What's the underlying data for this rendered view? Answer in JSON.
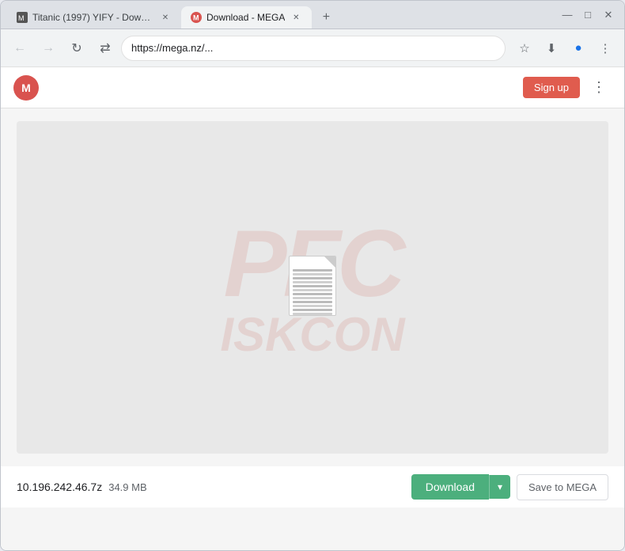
{
  "browser": {
    "tabs": [
      {
        "id": "tab1",
        "title": "Titanic (1997) YIFY - Download...",
        "favicon": "film",
        "active": false
      },
      {
        "id": "tab2",
        "title": "Download - MEGA",
        "favicon": "mega",
        "active": true
      }
    ],
    "url": "https://mega.nz/...",
    "new_tab_label": "+",
    "nav": {
      "back_disabled": true,
      "forward_disabled": true
    }
  },
  "mega": {
    "logo_letter": "M",
    "signup_label": "Sign up",
    "menu_icon": "⋮"
  },
  "file": {
    "name": "10.196.242.46.7z",
    "size": "34.9 MB",
    "download_label": "Download",
    "download_arrow": "▾",
    "save_to_mega_label": "Save to MEGA"
  },
  "watermark": {
    "line1": "PFC",
    "line2": "ISKCON"
  },
  "icons": {
    "back": "←",
    "forward": "→",
    "reload": "↻",
    "translate": "⇄",
    "star": "☆",
    "download_page": "⬇",
    "profile": "●",
    "more": "⋮",
    "minimize": "—",
    "maximize": "□",
    "close": "✕"
  }
}
